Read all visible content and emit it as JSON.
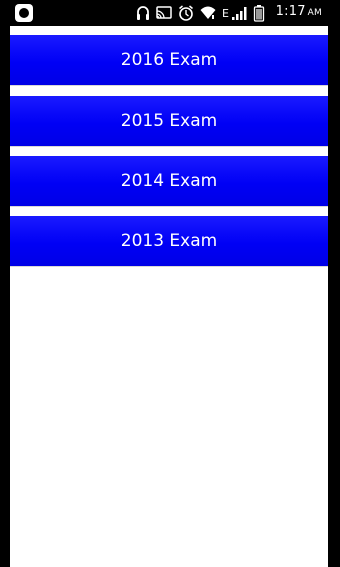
{
  "status_bar": {
    "icons": [
      "app-icon",
      "headphones-icon",
      "cast-icon",
      "alarm-icon",
      "wifi-icon",
      "signal-icon",
      "battery-icon"
    ],
    "network_type": "E",
    "time": "1:17",
    "ampm": "AM",
    "icon_color": "#ffffff",
    "background": "#000000"
  },
  "exam_list": {
    "items": [
      {
        "label": "2016 Exam"
      },
      {
        "label": "2015 Exam"
      },
      {
        "label": "2014 Exam"
      },
      {
        "label": "2013 Exam"
      }
    ],
    "button_color": "#0000f5",
    "text_color": "#ffffff"
  }
}
